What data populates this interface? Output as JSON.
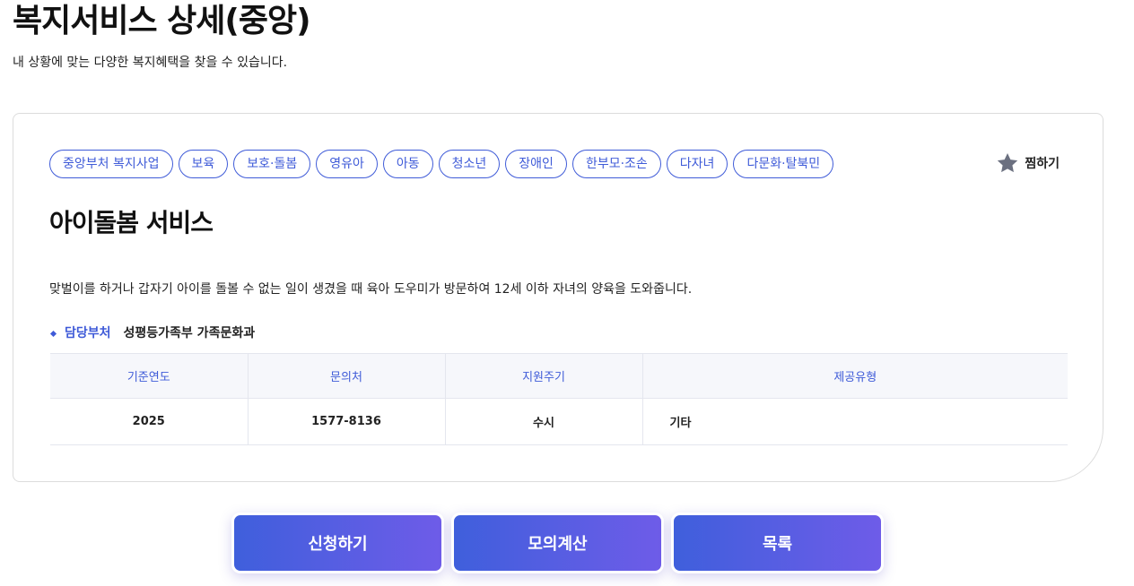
{
  "header": {
    "title": "복지서비스 상세(중앙)",
    "subtitle": "내 상황에 맞는 다양한 복지혜택을 찾을 수 있습니다."
  },
  "tags": [
    "중앙부처 복지사업",
    "보육",
    "보호·돌봄",
    "영유아",
    "아동",
    "청소년",
    "장애인",
    "한부모·조손",
    "다자녀",
    "다문화·탈북민"
  ],
  "favorite": {
    "label": "찜하기",
    "icon": "star-icon",
    "color": "#6b7080"
  },
  "service": {
    "title": "아이돌봄 서비스",
    "description": "맞벌이를 하거나 갑자기 아이를 돌볼 수 없는 일이 생겼을 때 육아 도우미가 방문하여 12세 이하 자녀의 양육을 도와줍니다.",
    "department_label": "담당부처",
    "department_value": "성평등가족부 가족문화과"
  },
  "table": {
    "headers": [
      "기준연도",
      "문의처",
      "지원주기",
      "제공유형"
    ],
    "row": [
      "2025",
      "1577-8136",
      "수시",
      "기타"
    ]
  },
  "buttons": {
    "apply": "신청하기",
    "simulate": "모의계산",
    "list": "목록"
  },
  "colors": {
    "accent": "#3f5bd8",
    "button_gradient_start": "#3f5fdc",
    "button_gradient_end": "#6e5ce8"
  }
}
